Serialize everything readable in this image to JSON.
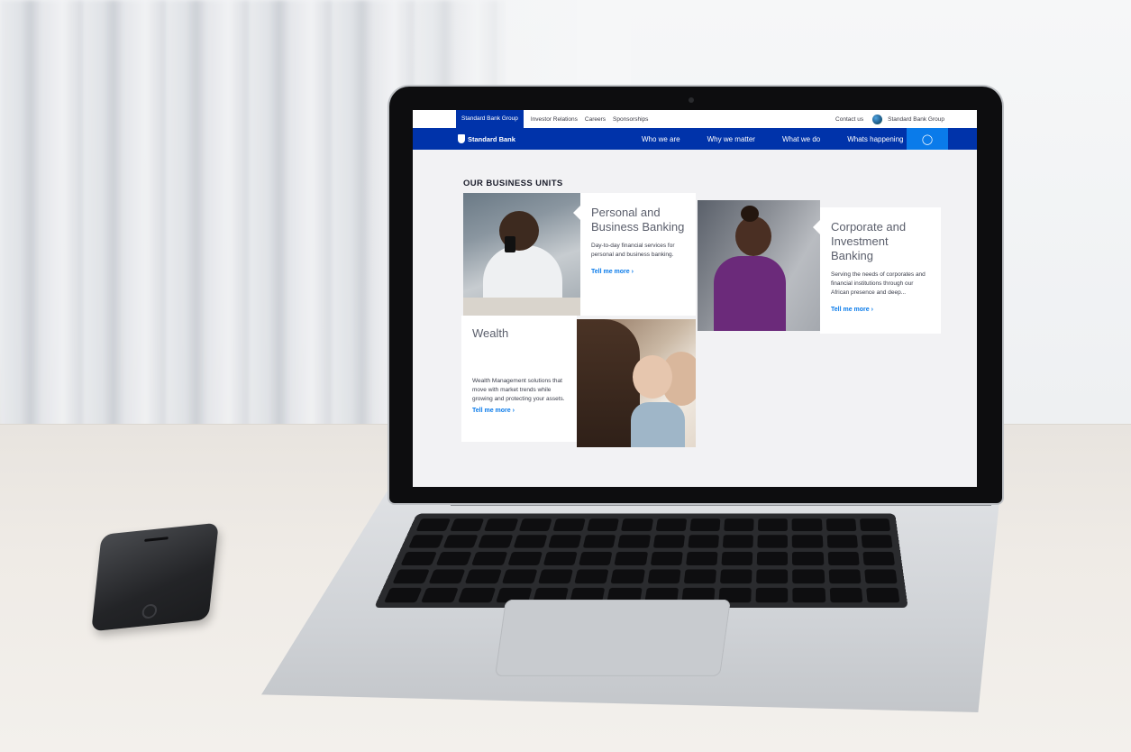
{
  "topbar": {
    "group_tab": "Standard Bank Group",
    "links": [
      "Investor Relations",
      "Careers",
      "Sponsorships"
    ],
    "contact": "Contact us",
    "group_select": "Standard Bank Group"
  },
  "navbar": {
    "logo": "Standard Bank",
    "items": [
      "Who we are",
      "Why we matter",
      "What we do",
      "Whats happening"
    ],
    "search_icon": "search-icon",
    "user_icon": "user-icon"
  },
  "section": {
    "title": "OUR BUSINESS UNITS"
  },
  "cards": [
    {
      "title": "Personal and Business Banking",
      "text": "Day-to-day financial services for personal and business banking.",
      "link": "Tell me more ›"
    },
    {
      "title": "Corporate and Investment Banking",
      "text": "Serving the needs of corporates and financial institutions through our African presence and deep...",
      "link": "Tell me more ›"
    },
    {
      "title": "Wealth",
      "text": "Wealth Management solutions that move with market trends while growing and protecting your assets.",
      "link": "Tell me more ›"
    }
  ],
  "colors": {
    "brand_blue": "#0033aa",
    "accent_blue": "#0a7bea"
  }
}
